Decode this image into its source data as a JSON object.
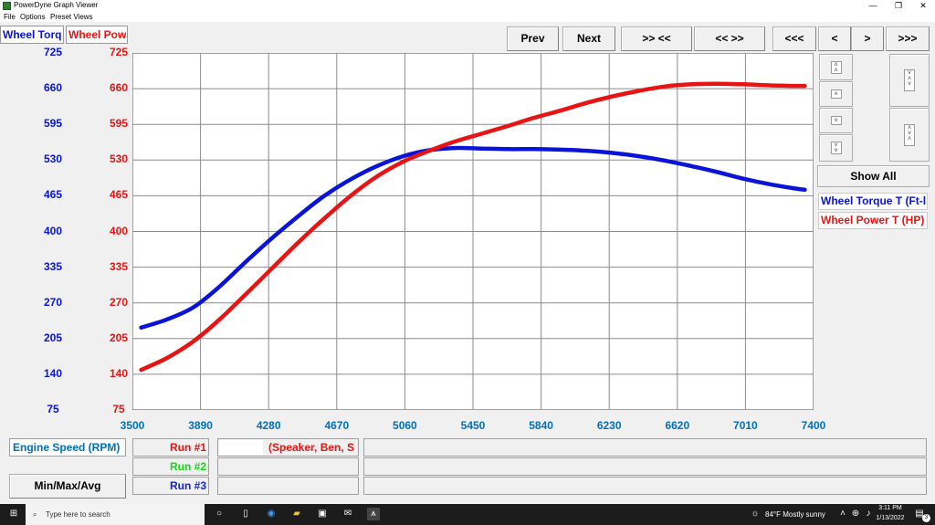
{
  "window": {
    "title": "PowerDyne Graph Viewer",
    "controls": [
      "—",
      "❐",
      "✕"
    ]
  },
  "menu": [
    "File",
    "Options",
    "Preset Views"
  ],
  "toolbar": {
    "prev": "Prev",
    "next": "Next",
    "zoom_in": ">> <<",
    "zoom_out": "<< >>",
    "first": "<<<",
    "left": "<",
    "right": ">",
    "last": ">>>"
  },
  "legend_top": {
    "torque": "Wheel Torq",
    "power": "Wheel Pow"
  },
  "colors": {
    "torque": "#0a14d8",
    "power": "#e81414",
    "run1": "#e81414",
    "run2": "#18d818",
    "run3": "#1428c8",
    "xaxis": "#0070c0"
  },
  "side": {
    "show_all": "Show All",
    "legend_torque": "Wheel Torque T (Ft-l",
    "legend_power": "Wheel Power T (HP)",
    "icons": [
      "scroll-top-icon",
      "scroll-up-icon",
      "scroll-down-icon",
      "scroll-bottom-icon",
      "expand-icon",
      "compress-icon"
    ]
  },
  "bottom": {
    "engine_speed": "Engine Speed (RPM)",
    "minmax": "Min/Max/Avg",
    "run1": "Run #1",
    "run2": "Run #2",
    "run3": "Run #3",
    "run1_name": "(Speaker, Ben, S"
  },
  "taskbar": {
    "search_placeholder": "Type here to search",
    "weather": "84°F  Mostly sunny",
    "time": "3:11 PM",
    "date": "1/13/2022",
    "notif_count": "3"
  },
  "chart_data": {
    "type": "line",
    "title": "",
    "xlabel": "Engine Speed (RPM)",
    "x_ticks": [
      "3500",
      "3890",
      "4280",
      "4670",
      "5060",
      "5450",
      "5840",
      "6230",
      "6620",
      "7010",
      "7400"
    ],
    "y_ticks_left": [
      "725",
      "660",
      "595",
      "530",
      "465",
      "400",
      "335",
      "270",
      "205",
      "140",
      "75"
    ],
    "y_ticks_right": [
      "725",
      "660",
      "595",
      "530",
      "465",
      "400",
      "335",
      "270",
      "205",
      "140",
      "75"
    ],
    "xlim": [
      3500,
      7400
    ],
    "ylim": [
      75,
      725
    ],
    "grid": true,
    "series": [
      {
        "name": "Wheel Torque T (Ft-l",
        "color": "#0a14d8",
        "x": [
          3550,
          3700,
          3850,
          4000,
          4150,
          4300,
          4450,
          4600,
          4750,
          4900,
          5050,
          5200,
          5350,
          5500,
          5650,
          5800,
          5950,
          6100,
          6250,
          6400,
          6550,
          6700,
          6850,
          7000,
          7150,
          7300,
          7350
        ],
        "y": [
          225,
          240,
          262,
          300,
          345,
          388,
          428,
          465,
          495,
          519,
          537,
          548,
          552,
          551,
          550,
          550,
          549,
          547,
          543,
          537,
          529,
          519,
          508,
          496,
          486,
          478,
          476
        ]
      },
      {
        "name": "Wheel Power T (HP)",
        "color": "#e81414",
        "x": [
          3550,
          3700,
          3850,
          4000,
          4150,
          4300,
          4450,
          4600,
          4750,
          4900,
          5050,
          5200,
          5350,
          5500,
          5650,
          5800,
          5950,
          6100,
          6250,
          6400,
          6550,
          6700,
          6850,
          7000,
          7150,
          7300,
          7350
        ],
        "y": [
          148,
          170,
          200,
          240,
          286,
          333,
          380,
          424,
          465,
          500,
          527,
          547,
          564,
          578,
          592,
          607,
          620,
          634,
          646,
          656,
          664,
          668,
          669,
          668,
          666,
          665,
          665
        ]
      }
    ]
  }
}
